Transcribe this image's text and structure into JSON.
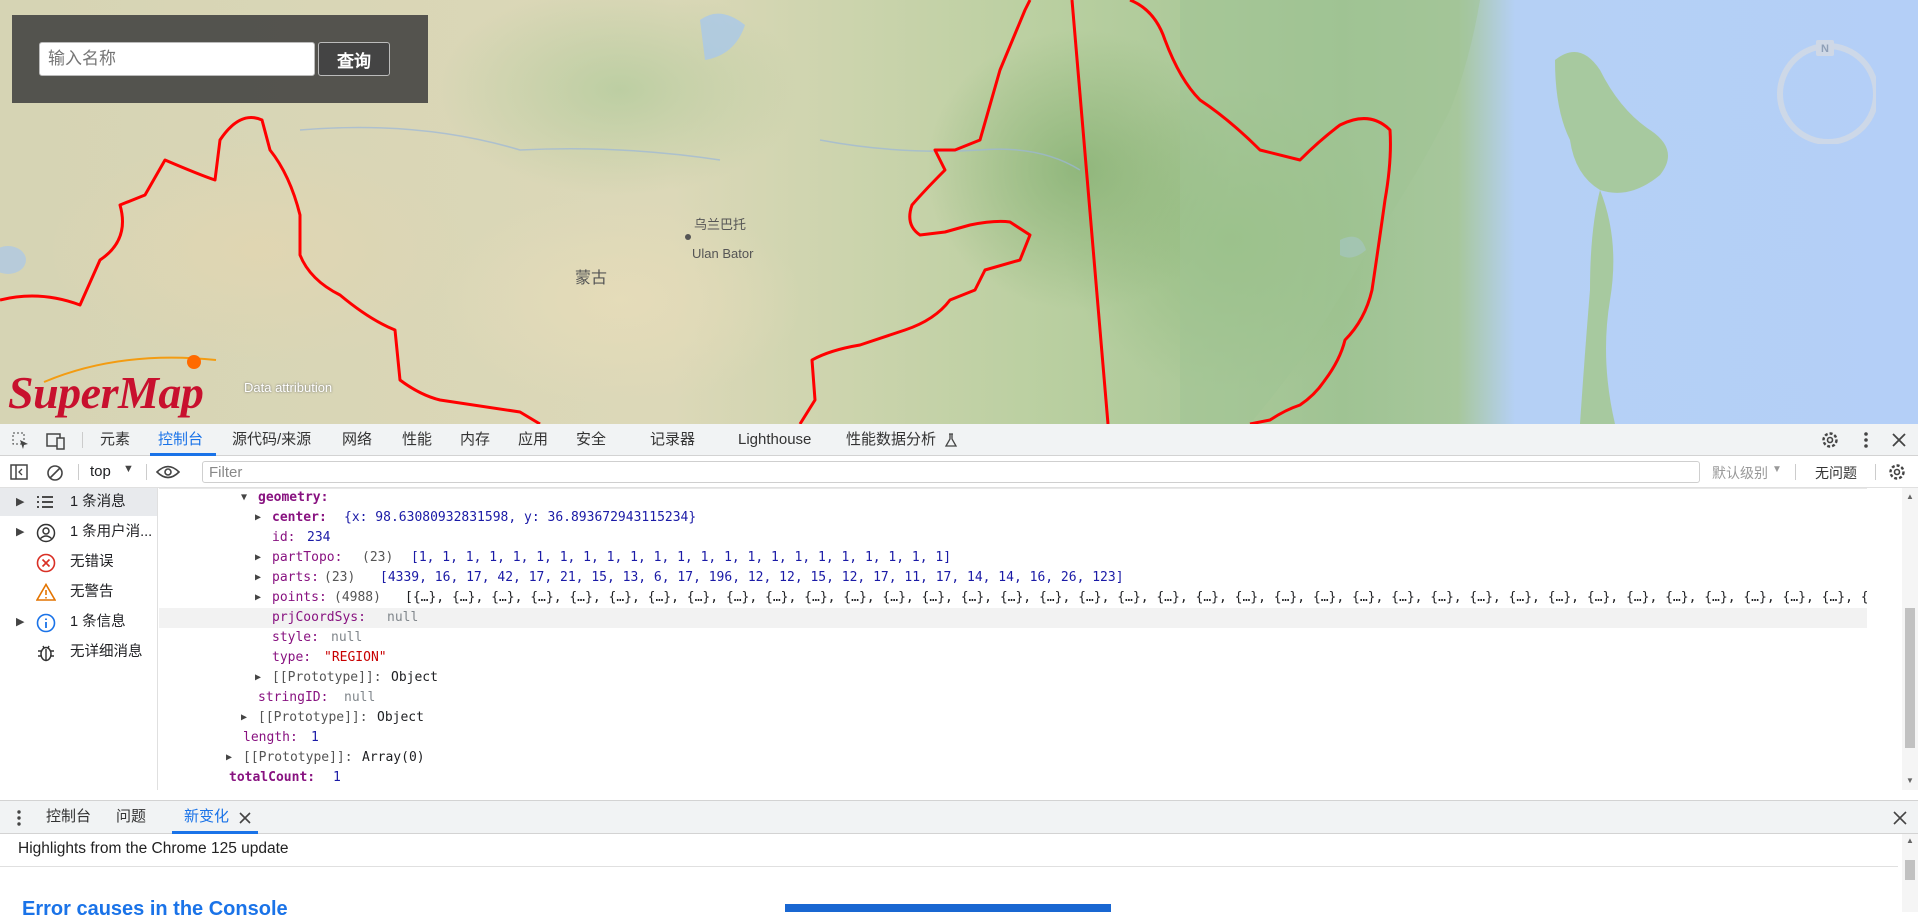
{
  "map": {
    "search_placeholder": "输入名称",
    "search_button": "查询",
    "labels": {
      "mongolia": "蒙古",
      "ulaanbaatar_cn": "乌兰巴托",
      "ulaanbaatar_en": "Ulan Bator"
    },
    "logo_text": "SuperMap",
    "attribution": "Data attribution",
    "compass_north": "N"
  },
  "devtools": {
    "tabs": [
      {
        "label": "元素"
      },
      {
        "label": "控制台"
      },
      {
        "label": "源代码/来源"
      },
      {
        "label": "网络"
      },
      {
        "label": "性能"
      },
      {
        "label": "内存"
      },
      {
        "label": "应用"
      },
      {
        "label": "安全"
      },
      {
        "label": "记录器"
      },
      {
        "label": "Lighthouse"
      },
      {
        "label": "性能数据分析"
      }
    ],
    "active_tab": "控制台",
    "context": "top",
    "filter_placeholder": "Filter",
    "level": "默认级别",
    "issues": "无问题",
    "sidebar": [
      {
        "label": "1 条消息"
      },
      {
        "label": "1 条用户消..."
      },
      {
        "label": "无错误"
      },
      {
        "label": "无警告"
      },
      {
        "label": "1 条信息"
      },
      {
        "label": "无详细消息"
      }
    ],
    "console": {
      "geometry_key": "geometry:",
      "center_key": "center:",
      "center_val": "{x: 98.63080932831598, y: 36.893672943115234}",
      "id_key": "id:",
      "id_val": "234",
      "partTopo_key": "partTopo:",
      "partTopo_len": "(23)",
      "partTopo_val": "[1, 1, 1, 1, 1, 1, 1, 1, 1, 1, 1, 1, 1, 1, 1, 1, 1, 1, 1, 1, 1, 1, 1]",
      "parts_key": "parts:",
      "parts_len": "(23)",
      "parts_val": "[4339, 16, 17, 42, 17, 21, 15, 13, 6, 17, 196, 12, 12, 15, 12, 17, 11, 17, 14, 14, 16, 26, 123]",
      "points_key": "points:",
      "points_len": "(4988)",
      "points_val": "[{…}, {…}, {…}, {…}, {…}, {…}, {…}, {…}, {…}, {…}, {…}, {…}, {…}, {…}, {…}, {…}, {…}, {…}, {…}, {…}, {…}, {…}, {…}, {…}, {…}, {…}, {…}, {…}, {…}, {…}, {…}, {…}, {…}, {…}, {…}, {…}, {…}, {…}, {…}, {…}, {…}, {…}, {…}, {…}, {…}, {…}, {…}, {…}, {…}, {…}, {…}, {…}, {…}, {…}, {…}, {…}, {…}, {…}, {…}, {…}, {…}, {…}, {…}, {…}, {…}, {…}, {…}, {…}, {…}, {…}, {…}, {…}, {…}, {…}, {…}, {…}, {…}, {…}, {…}, {…}, {…}, {…}, {…}, {…}, {…}, {…}, {…}, {…}, {…}, {…}, {…}, {…}, {…}, {…}, {…}, {…}, {…}, {…}, {…}, {…}, …]",
      "prjCoordSys_key": "prjCoordSys:",
      "style_key": "style:",
      "type_key": "type:",
      "type_val": "\"REGION\"",
      "null": "null",
      "proto_key": "[[Prototype]]:",
      "object": "Object",
      "stringID_key": "stringID:",
      "length_key": "length:",
      "length_val": "1",
      "array0": "Array(0)",
      "totalCount_key": "totalCount:",
      "totalCount_val": "1"
    },
    "drawer_tabs": [
      {
        "label": "控制台"
      },
      {
        "label": "问题"
      },
      {
        "label": "新变化"
      }
    ],
    "whatsnew_title": "Highlights from the Chrome 125 update",
    "article_title": "Error causes in the Console"
  },
  "colors": {
    "border_red": "#ff0000",
    "accent_blue": "#1a73e8",
    "logo_red": "#c8102e"
  }
}
